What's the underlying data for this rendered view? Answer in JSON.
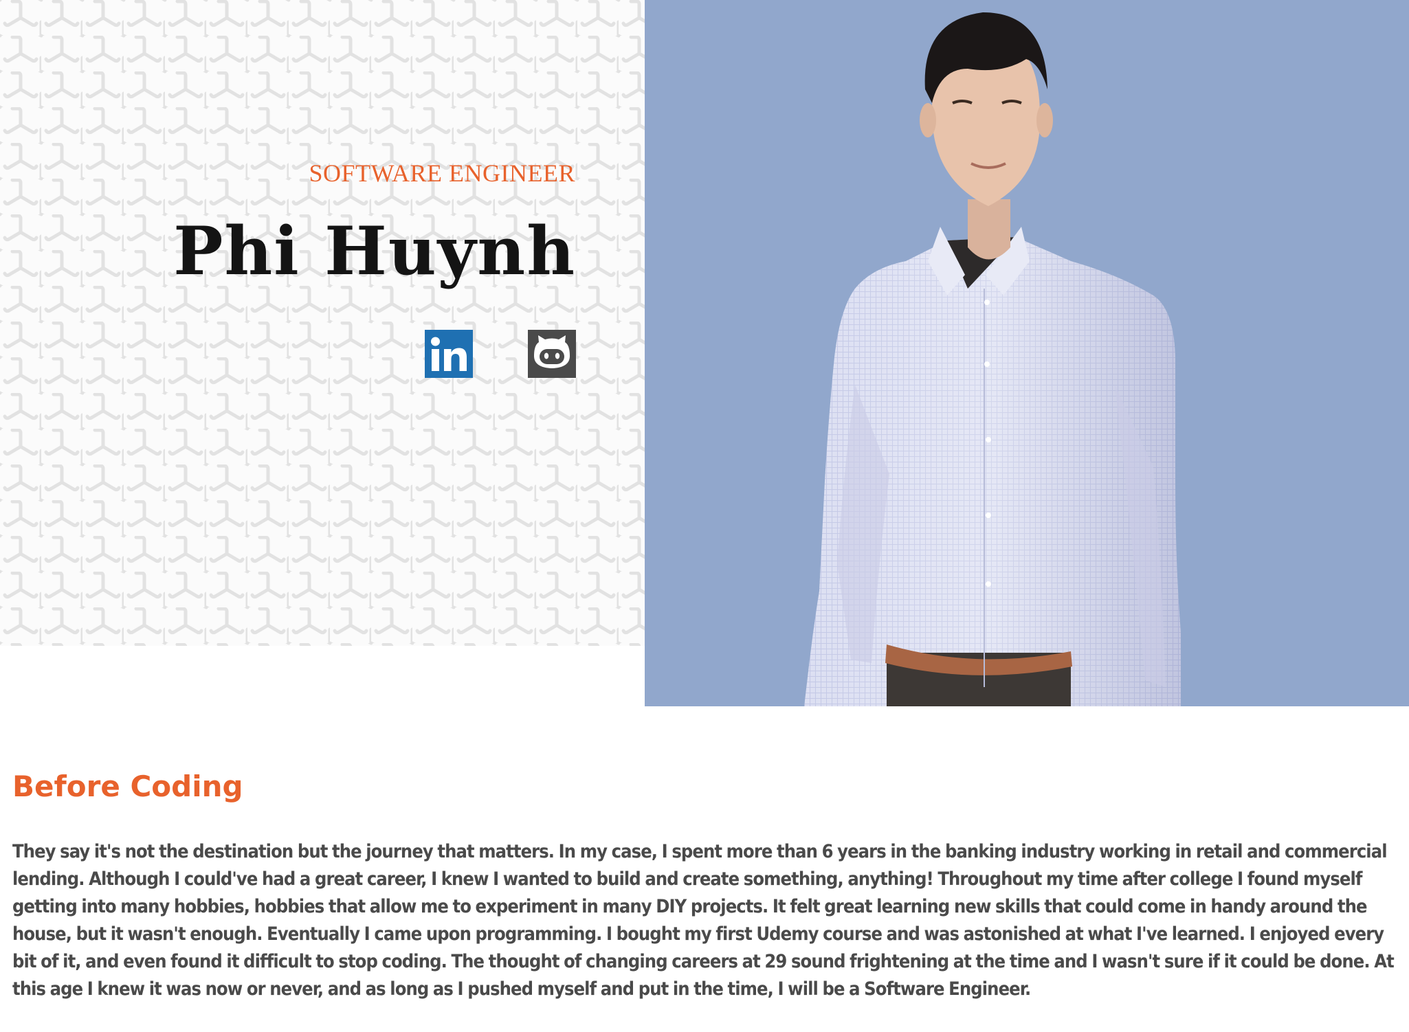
{
  "hero": {
    "subtitle": "SOFTWARE ENGINEER",
    "name": "Phi Huynh",
    "social_links": [
      {
        "icon": "linkedin-icon",
        "label": "in"
      },
      {
        "icon": "github-icon"
      }
    ],
    "photo": {
      "subject": "portrait-photo"
    }
  },
  "about": {
    "heading": "Before Coding",
    "body": "They say it's not the destination but the journey that matters. In my case, I spent more than 6 years in the banking industry working in retail and commercial lending. Although I could've had a great career, I knew I wanted to build and create something, anything! Throughout my time after college I found myself getting into many hobbies, hobbies that allow me to experiment in many DIY projects. It felt great learning new skills that could come in handy around the house, but it wasn't enough. Eventually I came upon programming. I bought my first Udemy course and was astonished at what I've learned. I enjoyed every bit of it, and even found it difficult to stop coding. The thought of changing careers at 29 sound frightening at the time and I wasn't sure if it could be done. At this age I knew it was now or never, and as long as I pushed myself and put in the time, I will be a Software Engineer."
  },
  "colors": {
    "accent": "#e8622c",
    "heading_text": "#141414",
    "body_text": "#4a4a4a",
    "photo_background": "#91a7cc",
    "pattern_stroke": "#e2e2e2",
    "linkedin_blue": "#1f70b2",
    "github_gray": "#4a4a4a"
  }
}
